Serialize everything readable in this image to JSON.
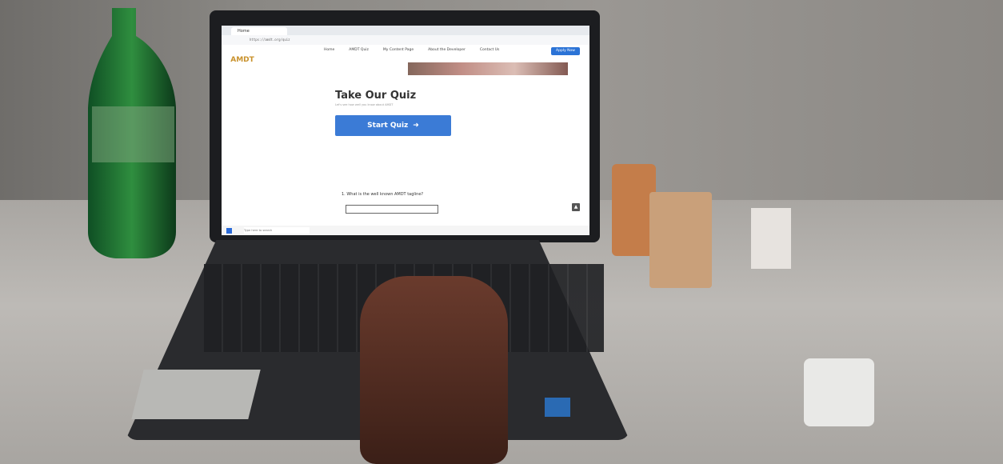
{
  "browser": {
    "tab_title": "Home",
    "url": "https://amdt.org/quiz"
  },
  "site": {
    "logo": "AMDT",
    "nav": [
      "Home",
      "AMDT Quiz",
      "My Content Page",
      "About the Developer",
      "Contact Us"
    ],
    "apply_button": "Apply Now",
    "quiz_title": "Take Our Quiz",
    "quiz_subtitle": "Let's see how well you know about AMDT",
    "start_button": "Start Quiz",
    "question_1": "1.  What is the well known AMDT tagline?",
    "scroll_top_icon": "▲"
  },
  "taskbar": {
    "search_placeholder": "Type here to search"
  },
  "icons": {
    "start": "windows-icon",
    "arrow": "arrow-down-icon"
  }
}
